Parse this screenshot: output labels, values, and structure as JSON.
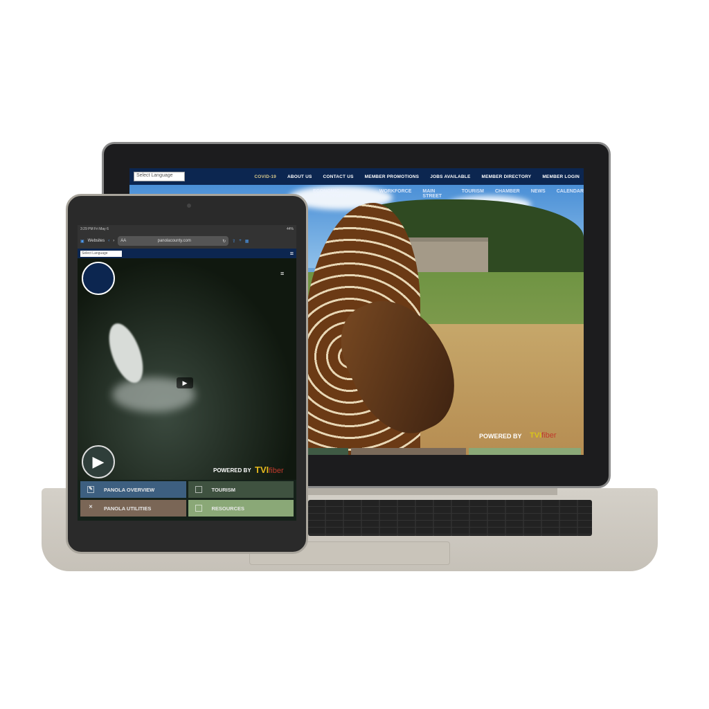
{
  "laptop": {
    "language_select": "Select Language",
    "top_nav": [
      "COVID-19",
      "ABOUT US",
      "CONTACT US",
      "MEMBER PROMOTIONS",
      "JOBS AVAILABLE",
      "MEMBER DIRECTORY",
      "MEMBER LOGIN"
    ],
    "main_nav": [
      "ECONOMIC DEVELOPMENT",
      "WORKFORCE",
      "MAIN STREET",
      "TOURISM",
      "CHAMBER",
      "NEWS",
      "CALENDAR"
    ],
    "powered_by": "POWERED BY",
    "brand_tvi": "TVI",
    "brand_fiber": "fiber",
    "tile_colors": [
      "#3f5a44",
      "#7a6a5a",
      "#8aa877"
    ]
  },
  "tablet": {
    "status_time": "3:29 PM  Fri May 6",
    "battery": "44%",
    "tabs_label": "Websites",
    "url_aa": "AA",
    "url": "panolacounty.com",
    "language_select": "Select Language",
    "play_icon": "play-icon",
    "powered_by": "POWERED BY",
    "brand_tvi": "TVI",
    "brand_fiber": "fiber",
    "tiles": [
      {
        "label": "PANOLA OVERVIEW",
        "color": "#3d5f80",
        "icon": "clipboard-icon"
      },
      {
        "label": "TOURISM",
        "color": "#3f5240",
        "icon": "bag-icon"
      },
      {
        "label": "PANOLA UTILITIES",
        "color": "#7a6656",
        "icon": "tools-icon"
      },
      {
        "label": "RESOURCES",
        "color": "#8aa877",
        "icon": "tablet-icon"
      }
    ]
  }
}
